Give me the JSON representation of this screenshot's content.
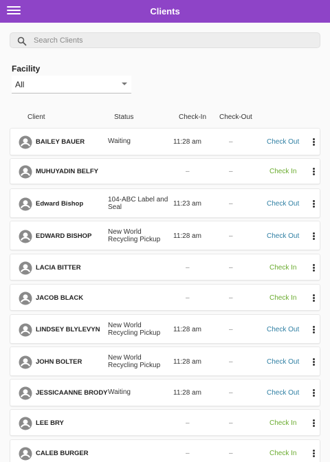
{
  "header": {
    "title": "Clients",
    "menu_icon": "hamburger-menu-icon"
  },
  "search": {
    "placeholder": "Search Clients",
    "value": "",
    "icon": "search-icon"
  },
  "facility": {
    "label": "Facility",
    "selected": "All"
  },
  "table": {
    "columns": [
      "Client",
      "Status",
      "Check-In",
      "Check-Out"
    ],
    "rows": [
      {
        "client": "BAILEY BAUER",
        "status": "Waiting",
        "check_in": "11:28 am",
        "check_out": "–",
        "action": "Check Out"
      },
      {
        "client": "MUHUYADIN BELFY",
        "status": "",
        "check_in": "–",
        "check_out": "–",
        "action": "Check In"
      },
      {
        "client": "Edward Bishop",
        "status": "104-ABC Label and Seal",
        "check_in": "11:23 am",
        "check_out": "–",
        "action": "Check Out"
      },
      {
        "client": "EDWARD BISHOP",
        "status": "New World Recycling Pickup",
        "check_in": "11:28 am",
        "check_out": "–",
        "action": "Check Out"
      },
      {
        "client": "LACIA BITTER",
        "status": "",
        "check_in": "–",
        "check_out": "–",
        "action": "Check In"
      },
      {
        "client": "JACOB BLACK",
        "status": "",
        "check_in": "–",
        "check_out": "–",
        "action": "Check In"
      },
      {
        "client": "LINDSEY BLYLEVYN",
        "status": "New World Recycling Pickup",
        "check_in": "11:28 am",
        "check_out": "–",
        "action": "Check Out"
      },
      {
        "client": "JOHN BOLTER",
        "status": "New World Recycling Pickup",
        "check_in": "11:28 am",
        "check_out": "–",
        "action": "Check Out"
      },
      {
        "client": "JESSICAANNE BRODY",
        "status": "Waiting",
        "check_in": "11:28 am",
        "check_out": "–",
        "action": "Check Out"
      },
      {
        "client": "LEE BRY",
        "status": "",
        "check_in": "–",
        "check_out": "–",
        "action": "Check In"
      },
      {
        "client": "CALEB BURGER",
        "status": "",
        "check_in": "–",
        "check_out": "–",
        "action": "Check In"
      }
    ]
  },
  "colors": {
    "app_bar": "#8e44c7",
    "check_out": "#2f7fa3",
    "check_in": "#6aab2e"
  }
}
